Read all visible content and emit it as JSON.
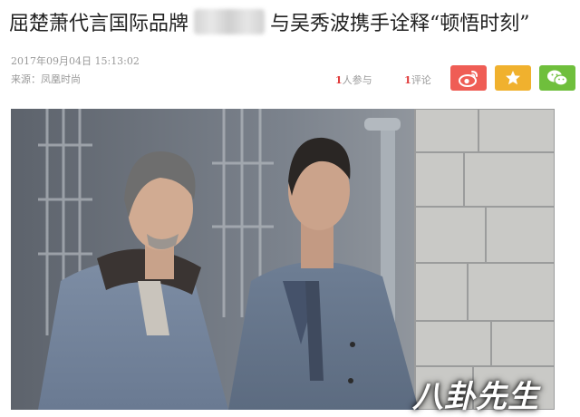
{
  "article": {
    "title_part1": "屈楚萧代言国际品牌",
    "title_part2": "与吴秀波携手诠释“顿悟时刻”",
    "datetime": "2017年09月04日  15:13:02",
    "source": "来源：凤凰时尚"
  },
  "stats": {
    "participants_count": "1",
    "participants_label": "人参与",
    "comments_count": "1",
    "comments_label": "评论"
  },
  "share": {
    "weibo_icon": "weibo-icon",
    "favorite_icon": "star-icon",
    "wechat_icon": "wechat-icon",
    "weibo_color": "#ef5d55",
    "favorite_color": "#f0b12e",
    "wechat_color": "#6fbf3c"
  },
  "photo": {
    "watermark": "八卦先生"
  }
}
